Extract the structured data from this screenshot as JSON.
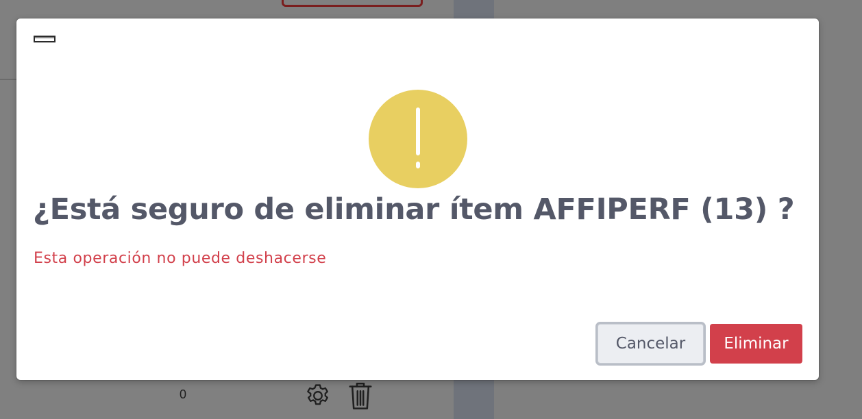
{
  "background": {
    "count_value": "0",
    "icons": [
      "gear-icon",
      "trash-icon"
    ]
  },
  "modal": {
    "icon": "warning-icon",
    "title": "¿Está seguro de eliminar ítem AFFIPERF (13) ?",
    "subtitle": "Esta operación no puede deshacerse",
    "buttons": {
      "cancel_label": "Cancelar",
      "delete_label": "Eliminar"
    }
  },
  "colors": {
    "warning": "#e8cf61",
    "danger": "#d2404b",
    "title_text": "#545868",
    "overlay": "#7f7f7f"
  }
}
